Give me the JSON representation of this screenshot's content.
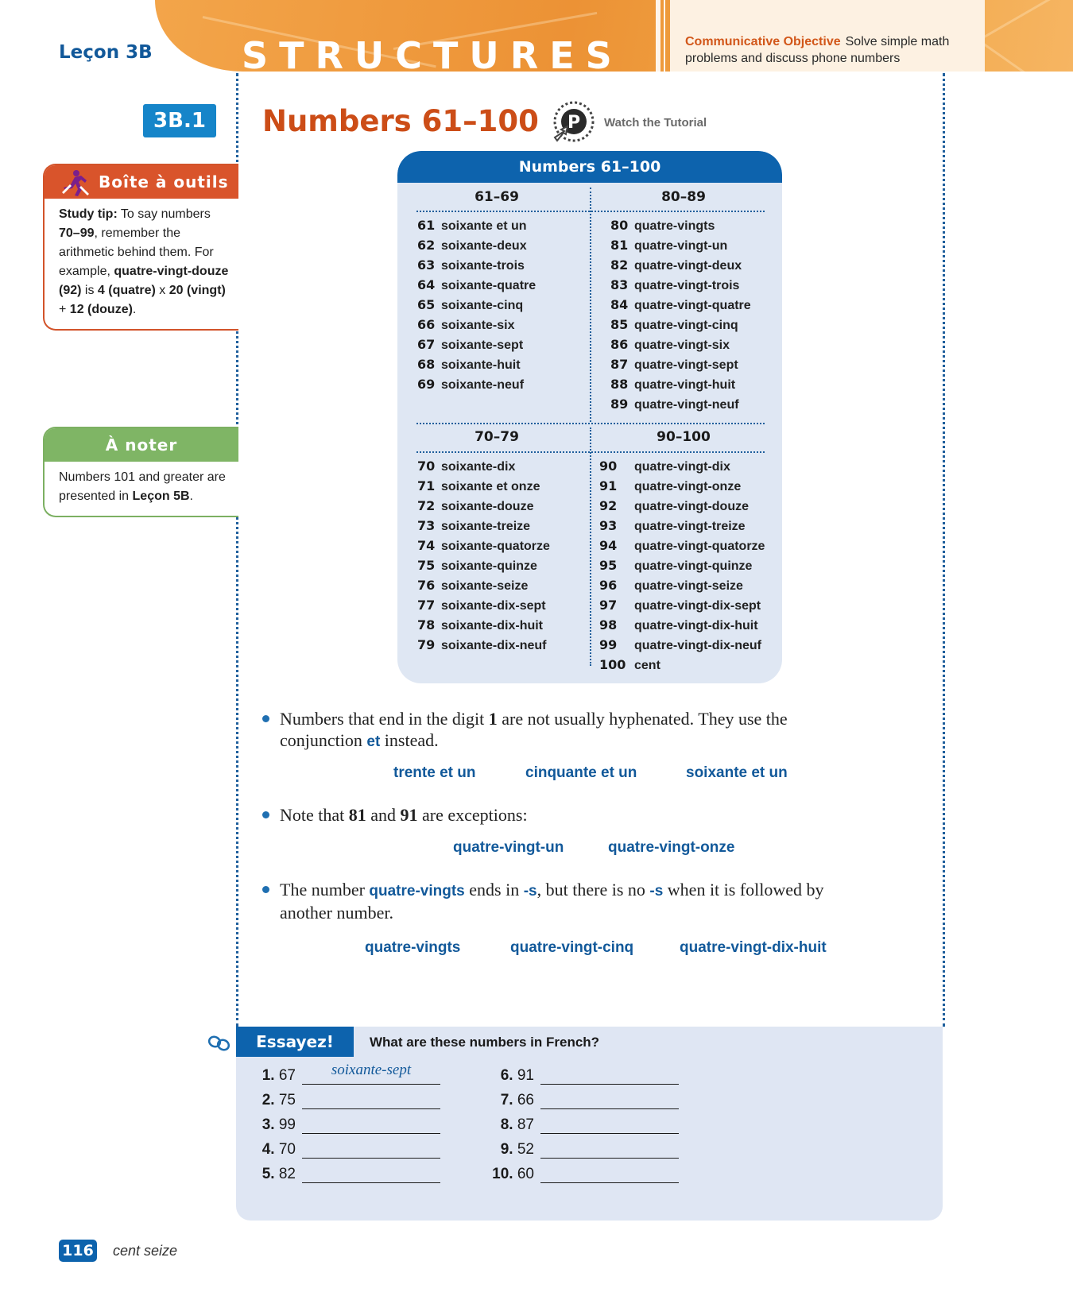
{
  "header": {
    "lesson": "Leçon 3B",
    "section_name": "STRUCTURES",
    "objective_label": "Communicative Objective",
    "objective_text": "Solve simple math problems and discuss phone numbers"
  },
  "section": {
    "badge": "3B.1",
    "title": "Numbers 61–100",
    "tutorial_label": "Watch the Tutorial",
    "tutorial_icon": "p-tutorial-icon"
  },
  "sidebar": {
    "outils": {
      "title": "Boîte à outils",
      "icon": "toolbox-runner-icon",
      "tip_label": "Study tip:",
      "tip_a": "To say numbers",
      "tip_range": "70–99",
      "tip_b": ", remember the arithmetic behind them. For example,",
      "tip_ex": "quatre-vingt-douze (92)",
      "tip_c": "is",
      "tip_4": "4 (quatre)",
      "tip_d": "x",
      "tip_20": "20 (vingt)",
      "tip_e": "+",
      "tip_12": "12 (douze)",
      "tip_f": "."
    },
    "noter": {
      "title": "À noter",
      "text": "Numbers 101 and greater are presented in",
      "ref": "Leçon 5B",
      "ref_end": "."
    }
  },
  "table": {
    "title": "Numbers 61–100",
    "groups": [
      {
        "heading": "61–69",
        "rows": [
          {
            "n": "61",
            "w": "soixante et un"
          },
          {
            "n": "62",
            "w": "soixante-deux"
          },
          {
            "n": "63",
            "w": "soixante-trois"
          },
          {
            "n": "64",
            "w": "soixante-quatre"
          },
          {
            "n": "65",
            "w": "soixante-cinq"
          },
          {
            "n": "66",
            "w": "soixante-six"
          },
          {
            "n": "67",
            "w": "soixante-sept"
          },
          {
            "n": "68",
            "w": "soixante-huit"
          },
          {
            "n": "69",
            "w": "soixante-neuf"
          }
        ]
      },
      {
        "heading": "80–89",
        "rows": [
          {
            "n": "80",
            "w": "quatre-vingts"
          },
          {
            "n": "81",
            "w": "quatre-vingt-un"
          },
          {
            "n": "82",
            "w": "quatre-vingt-deux"
          },
          {
            "n": "83",
            "w": "quatre-vingt-trois"
          },
          {
            "n": "84",
            "w": "quatre-vingt-quatre"
          },
          {
            "n": "85",
            "w": "quatre-vingt-cinq"
          },
          {
            "n": "86",
            "w": "quatre-vingt-six"
          },
          {
            "n": "87",
            "w": "quatre-vingt-sept"
          },
          {
            "n": "88",
            "w": "quatre-vingt-huit"
          },
          {
            "n": "89",
            "w": "quatre-vingt-neuf"
          }
        ]
      },
      {
        "heading": "70–79",
        "rows": [
          {
            "n": "70",
            "w": "soixante-dix"
          },
          {
            "n": "71",
            "w": "soixante et onze"
          },
          {
            "n": "72",
            "w": "soixante-douze"
          },
          {
            "n": "73",
            "w": "soixante-treize"
          },
          {
            "n": "74",
            "w": "soixante-quatorze"
          },
          {
            "n": "75",
            "w": "soixante-quinze"
          },
          {
            "n": "76",
            "w": "soixante-seize"
          },
          {
            "n": "77",
            "w": "soixante-dix-sept"
          },
          {
            "n": "78",
            "w": "soixante-dix-huit"
          },
          {
            "n": "79",
            "w": "soixante-dix-neuf"
          }
        ]
      },
      {
        "heading": "90–100",
        "rows": [
          {
            "n": "90",
            "w": "quatre-vingt-dix"
          },
          {
            "n": "91",
            "w": "quatre-vingt-onze"
          },
          {
            "n": "92",
            "w": "quatre-vingt-douze"
          },
          {
            "n": "93",
            "w": "quatre-vingt-treize"
          },
          {
            "n": "94",
            "w": "quatre-vingt-quatorze"
          },
          {
            "n": "95",
            "w": "quatre-vingt-quinze"
          },
          {
            "n": "96",
            "w": "quatre-vingt-seize"
          },
          {
            "n": "97",
            "w": "quatre-vingt-dix-sept"
          },
          {
            "n": "98",
            "w": "quatre-vingt-dix-huit"
          },
          {
            "n": "99",
            "w": "quatre-vingt-dix-neuf"
          },
          {
            "n": "100",
            "w": "cent"
          }
        ]
      }
    ]
  },
  "notes": {
    "note1": {
      "a": "Numbers that end in the digit",
      "digit": "1",
      "b": "are not usually hyphenated. They use the conjunction",
      "kw": "et",
      "c": "instead.",
      "examples": [
        "trente et un",
        "cinquante et un",
        "soixante et un"
      ]
    },
    "note2": {
      "a": "Note that",
      "n1": "81",
      "b": "and",
      "n2": "91",
      "c": "are exceptions:",
      "examples": [
        "quatre-vingt-un",
        "quatre-vingt-onze"
      ]
    },
    "note3": {
      "a": "The number",
      "kw": "quatre-vingts",
      "b": "ends in",
      "s1": "-s",
      "c": ", but there is no",
      "s2": "-s",
      "d": "when it is followed by another number.",
      "examples": [
        "quatre-vingts",
        "quatre-vingt-cinq",
        "quatre-vingt-dix-huit"
      ]
    }
  },
  "essayez": {
    "tab": "Essayez!",
    "instruction": "What are these numbers in French?",
    "icon": "link-chain-icon",
    "items": [
      {
        "num": "1.",
        "value": "67",
        "answer": "soixante-sept"
      },
      {
        "num": "2.",
        "value": "75",
        "answer": ""
      },
      {
        "num": "3.",
        "value": "99",
        "answer": ""
      },
      {
        "num": "4.",
        "value": "70",
        "answer": ""
      },
      {
        "num": "5.",
        "value": "82",
        "answer": ""
      },
      {
        "num": "6.",
        "value": "91",
        "answer": ""
      },
      {
        "num": "7.",
        "value": "66",
        "answer": ""
      },
      {
        "num": "8.",
        "value": "87",
        "answer": ""
      },
      {
        "num": "9.",
        "value": "52",
        "answer": ""
      },
      {
        "num": "10.",
        "value": "60",
        "answer": ""
      }
    ]
  },
  "footer": {
    "page_number": "116",
    "page_words": "cent seize"
  },
  "colors": {
    "brand_blue": "#0d63ad",
    "title_orange": "#cc4d17",
    "header_orange": "#ec9235",
    "outils_red": "#d9542b",
    "noter_green": "#7fb565",
    "panel_blue": "#dfe7f3"
  }
}
